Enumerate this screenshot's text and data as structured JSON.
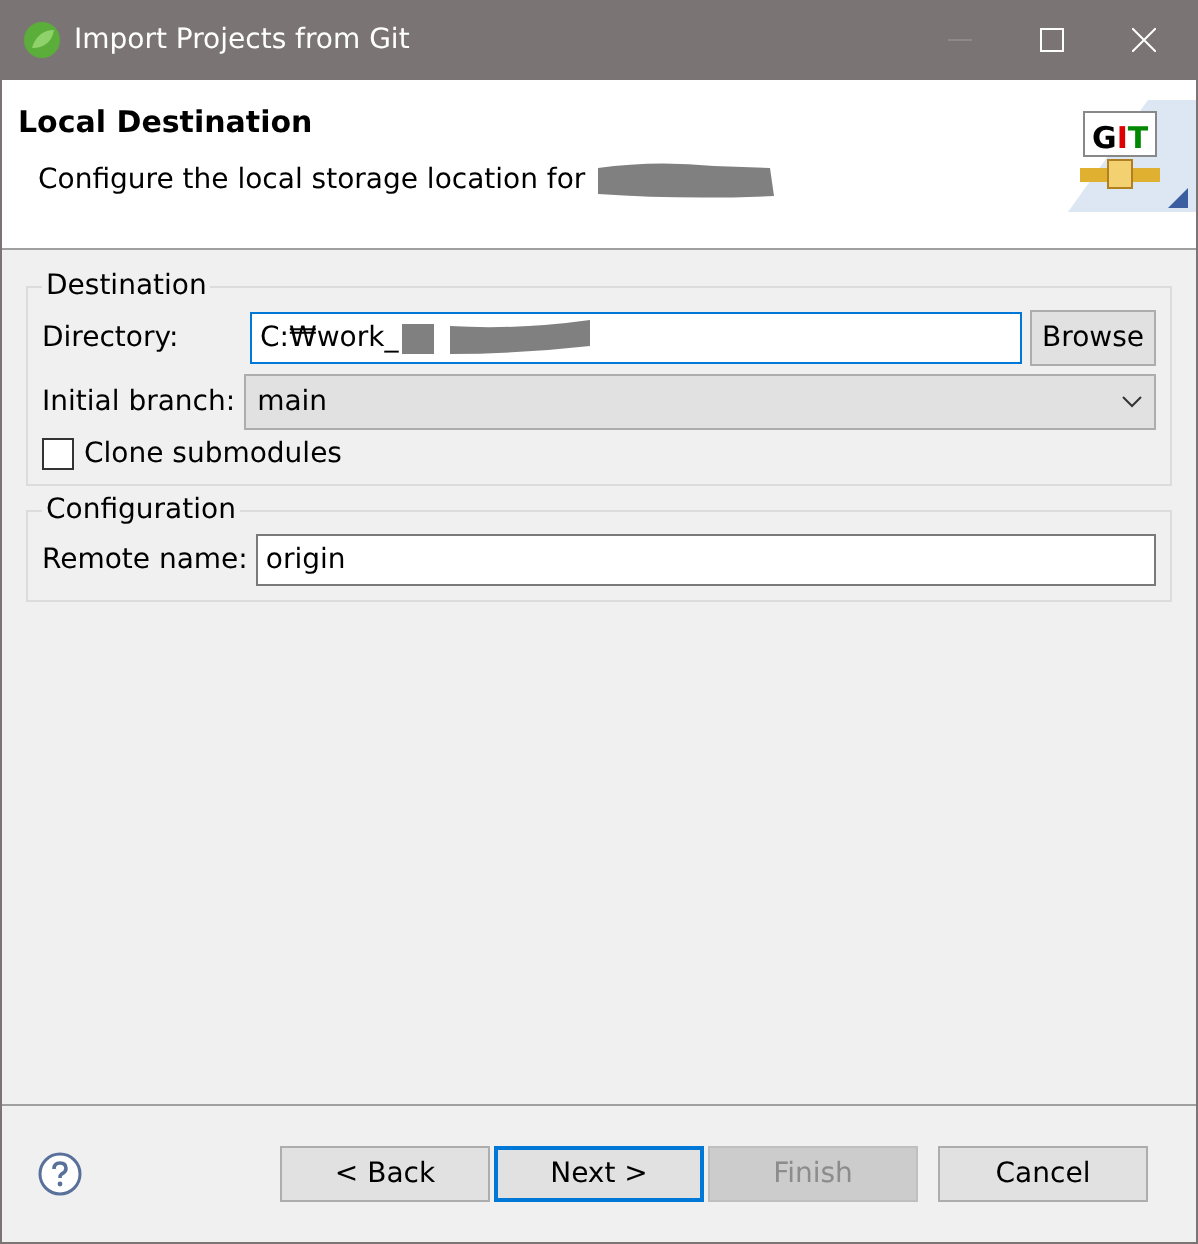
{
  "window": {
    "title": "Import Projects from Git"
  },
  "header": {
    "title": "Local Destination",
    "description": "Configure the local storage location for",
    "logo_letters": [
      {
        "text": "G",
        "color": "#000000"
      },
      {
        "text": "I",
        "color": "#dd0000"
      },
      {
        "text": "T",
        "color": "#008800"
      }
    ]
  },
  "destination": {
    "legend": "Destination",
    "directory_label": "Directory:",
    "directory_value": "C:₩work_",
    "browse": "Browse",
    "branch_label": "Initial branch:",
    "branch_value": "main",
    "clone_label": "Clone submodules",
    "clone_checked": false
  },
  "configuration": {
    "legend": "Configuration",
    "remote_label": "Remote name:",
    "remote_value": "origin"
  },
  "buttons": [
    {
      "label": "< Back",
      "disabled": false,
      "default": false
    },
    {
      "label": "Next >",
      "disabled": false,
      "default": true
    },
    {
      "label": "Finish",
      "disabled": true,
      "default": false
    },
    {
      "label": "Cancel",
      "disabled": false,
      "default": false
    }
  ]
}
